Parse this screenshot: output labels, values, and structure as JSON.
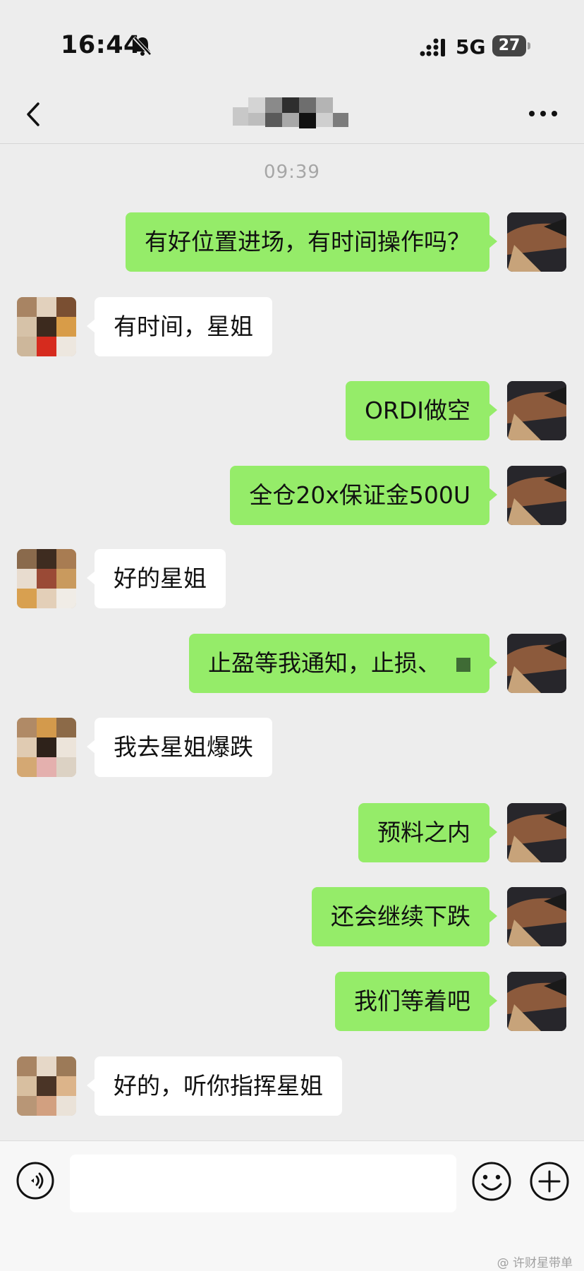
{
  "status_bar": {
    "time": "16:44",
    "network": "5G",
    "battery": "27",
    "icons": [
      "bell-off-icon",
      "signal-icon",
      "battery-icon"
    ]
  },
  "nav": {
    "icons": [
      "chevron-left-icon",
      "more-dots-icon"
    ]
  },
  "chat": {
    "timestamp": "09:39",
    "messages": [
      {
        "from": "me",
        "text": "有好位置进场，有时间操作吗？"
      },
      {
        "from": "other",
        "text": "有时间，星姐"
      },
      {
        "from": "me",
        "text": "ORDI做空"
      },
      {
        "from": "me",
        "text": "全仓20x保证金500U"
      },
      {
        "from": "other",
        "text": "好的星姐"
      },
      {
        "from": "me",
        "text": "止盈等我通知，止损、"
      },
      {
        "from": "other",
        "text": "我去星姐爆跌"
      },
      {
        "from": "me",
        "text": "预料之内"
      },
      {
        "from": "me",
        "text": "还会继续下跌"
      },
      {
        "from": "me",
        "text": "我们等着吧"
      },
      {
        "from": "other",
        "text": "好的，听你指挥星姐"
      }
    ]
  },
  "input_bar": {
    "value": "",
    "icons": [
      "voice-icon",
      "emoji-icon",
      "plus-icon"
    ],
    "watermark": "@ 许财星带单"
  },
  "colors": {
    "background": "#ededed",
    "outgoing_bubble": "#95ec69",
    "incoming_bubble": "#ffffff",
    "timestamp": "#a6a6a6"
  }
}
